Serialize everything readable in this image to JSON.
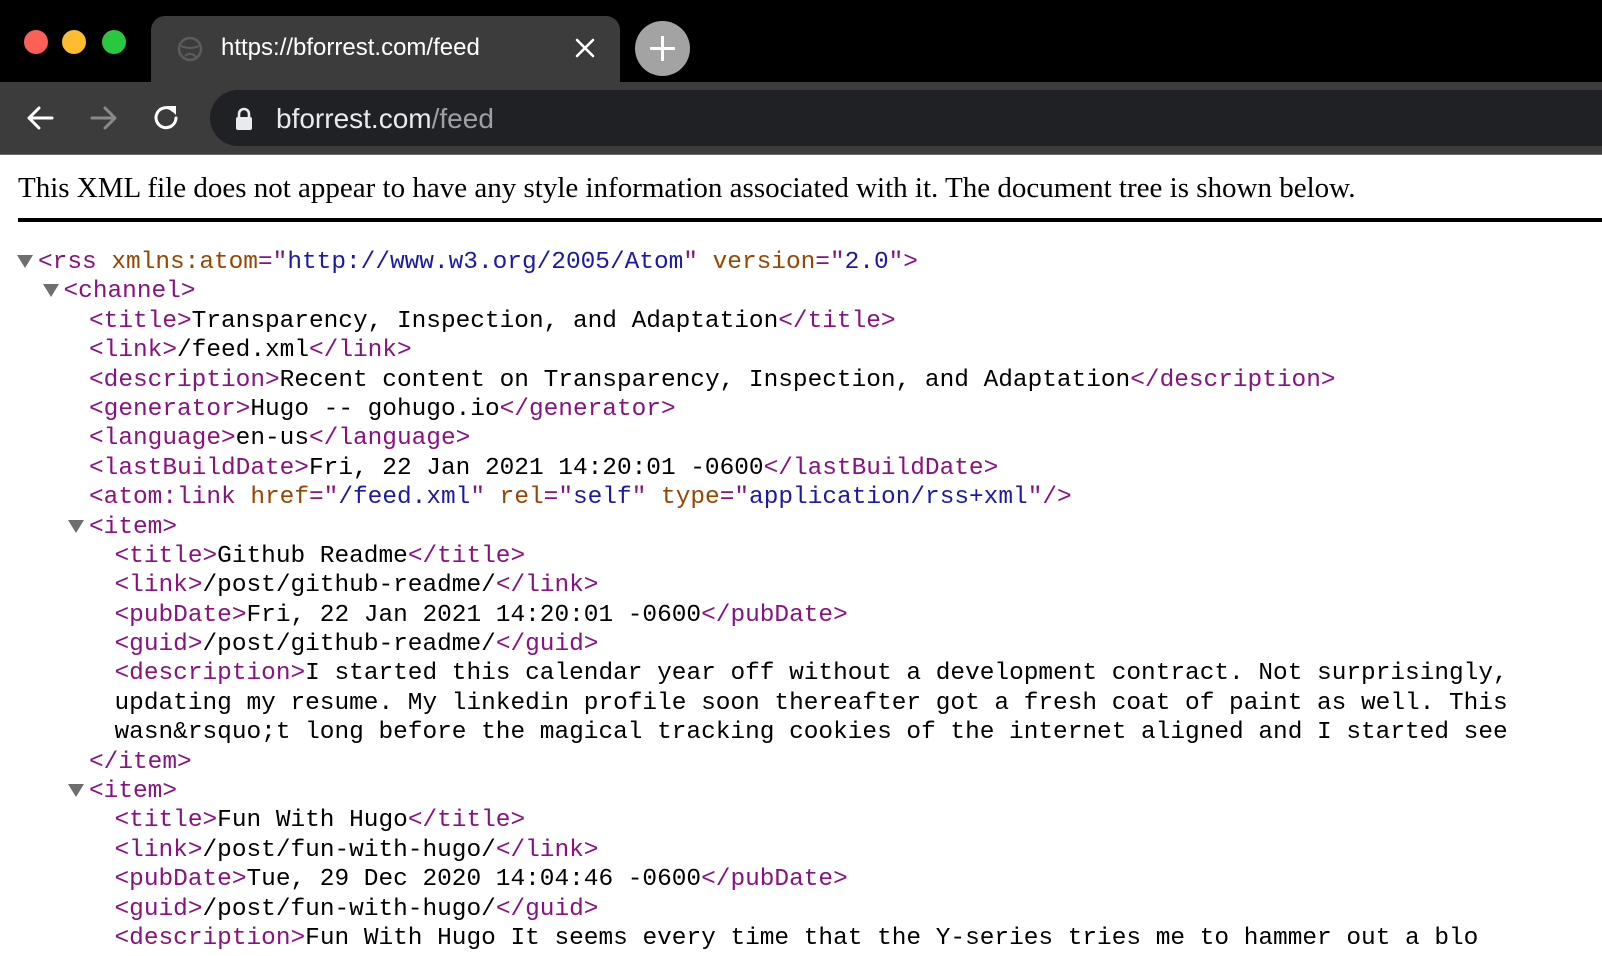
{
  "browser": {
    "tab": {
      "title": "https://bforrest.com/feed",
      "favicon": "globe-icon",
      "close_icon": "close-icon"
    },
    "new_tab_icon": "plus-icon",
    "nav": {
      "back": "arrow-left-icon",
      "forward": "arrow-right-icon",
      "reload": "reload-icon"
    },
    "url": {
      "host": "bforrest.com",
      "path": "/feed",
      "lock_icon": "lock-icon"
    }
  },
  "page": {
    "info": "This XML file does not appear to have any style information associated with it. The document tree is shown below.",
    "tree": [
      {
        "indent": 0,
        "arrow": true,
        "segs": [
          [
            "tag",
            "<rss "
          ],
          [
            "attr",
            "xmlns:atom"
          ],
          [
            "tag",
            "=\""
          ],
          [
            "val",
            "http://www.w3.org/2005/Atom"
          ],
          [
            "tag",
            "\" "
          ],
          [
            "attr",
            "version"
          ],
          [
            "tag",
            "=\""
          ],
          [
            "val",
            "2.0"
          ],
          [
            "tag",
            "\">"
          ]
        ]
      },
      {
        "indent": 1,
        "arrow": true,
        "segs": [
          [
            "tag",
            "<channel>"
          ]
        ]
      },
      {
        "indent": 2,
        "segs": [
          [
            "tag",
            "<title>"
          ],
          [
            "txt",
            "Transparency, Inspection, and Adaptation"
          ],
          [
            "tag",
            "</title>"
          ]
        ]
      },
      {
        "indent": 2,
        "segs": [
          [
            "tag",
            "<link>"
          ],
          [
            "txt",
            "/feed.xml"
          ],
          [
            "tag",
            "</link>"
          ]
        ]
      },
      {
        "indent": 2,
        "segs": [
          [
            "tag",
            "<description>"
          ],
          [
            "txt",
            "Recent content on Transparency, Inspection, and Adaptation"
          ],
          [
            "tag",
            "</description>"
          ]
        ]
      },
      {
        "indent": 2,
        "segs": [
          [
            "tag",
            "<generator>"
          ],
          [
            "txt",
            "Hugo -- gohugo.io"
          ],
          [
            "tag",
            "</generator>"
          ]
        ]
      },
      {
        "indent": 2,
        "segs": [
          [
            "tag",
            "<language>"
          ],
          [
            "txt",
            "en-us"
          ],
          [
            "tag",
            "</language>"
          ]
        ]
      },
      {
        "indent": 2,
        "segs": [
          [
            "tag",
            "<lastBuildDate>"
          ],
          [
            "txt",
            "Fri, 22 Jan 2021 14:20:01 -0600"
          ],
          [
            "tag",
            "</lastBuildDate>"
          ]
        ]
      },
      {
        "indent": 2,
        "segs": [
          [
            "tag",
            "<atom:link "
          ],
          [
            "attr",
            "href"
          ],
          [
            "tag",
            "=\""
          ],
          [
            "val",
            "/feed.xml"
          ],
          [
            "tag",
            "\" "
          ],
          [
            "attr",
            "rel"
          ],
          [
            "tag",
            "=\""
          ],
          [
            "val",
            "self"
          ],
          [
            "tag",
            "\" "
          ],
          [
            "attr",
            "type"
          ],
          [
            "tag",
            "=\""
          ],
          [
            "val",
            "application/rss+xml"
          ],
          [
            "tag",
            "\"/>"
          ]
        ]
      },
      {
        "indent": 2,
        "arrow": true,
        "segs": [
          [
            "tag",
            "<item>"
          ]
        ]
      },
      {
        "indent": 3,
        "segs": [
          [
            "tag",
            "<title>"
          ],
          [
            "txt",
            "Github Readme"
          ],
          [
            "tag",
            "</title>"
          ]
        ]
      },
      {
        "indent": 3,
        "segs": [
          [
            "tag",
            "<link>"
          ],
          [
            "txt",
            "/post/github-readme/"
          ],
          [
            "tag",
            "</link>"
          ]
        ]
      },
      {
        "indent": 3,
        "segs": [
          [
            "tag",
            "<pubDate>"
          ],
          [
            "txt",
            "Fri, 22 Jan 2021 14:20:01 -0600"
          ],
          [
            "tag",
            "</pubDate>"
          ]
        ]
      },
      {
        "indent": 3,
        "segs": [
          [
            "tag",
            "<guid>"
          ],
          [
            "txt",
            "/post/github-readme/"
          ],
          [
            "tag",
            "</guid>"
          ]
        ]
      },
      {
        "indent": 3,
        "segs": [
          [
            "tag",
            "<description>"
          ],
          [
            "txt",
            "I started this calendar year off without a development contract. Not surprisingly,"
          ]
        ]
      },
      {
        "indent": 3,
        "segs": [
          [
            "txt",
            "updating my resume. My linkedin profile soon thereafter got a fresh coat of paint as well. This"
          ]
        ]
      },
      {
        "indent": 3,
        "segs": [
          [
            "txt",
            "wasn&rsquo;t long before the magical tracking cookies of the internet aligned and I started see"
          ]
        ]
      },
      {
        "indent": 2,
        "segs": [
          [
            "tag",
            "</item>"
          ]
        ]
      },
      {
        "indent": 2,
        "arrow": true,
        "segs": [
          [
            "tag",
            "<item>"
          ]
        ]
      },
      {
        "indent": 3,
        "segs": [
          [
            "tag",
            "<title>"
          ],
          [
            "txt",
            "Fun With Hugo"
          ],
          [
            "tag",
            "</title>"
          ]
        ]
      },
      {
        "indent": 3,
        "segs": [
          [
            "tag",
            "<link>"
          ],
          [
            "txt",
            "/post/fun-with-hugo/"
          ],
          [
            "tag",
            "</link>"
          ]
        ]
      },
      {
        "indent": 3,
        "segs": [
          [
            "tag",
            "<pubDate>"
          ],
          [
            "txt",
            "Tue, 29 Dec 2020 14:04:46 -0600"
          ],
          [
            "tag",
            "</pubDate>"
          ]
        ]
      },
      {
        "indent": 3,
        "segs": [
          [
            "tag",
            "<guid>"
          ],
          [
            "txt",
            "/post/fun-with-hugo/"
          ],
          [
            "tag",
            "</guid>"
          ]
        ]
      },
      {
        "indent": 3,
        "segs": [
          [
            "tag",
            "<description>"
          ],
          [
            "txt",
            "Fun With Hugo It seems every time that the Y-series tries me to hammer out a blo"
          ]
        ]
      }
    ]
  }
}
